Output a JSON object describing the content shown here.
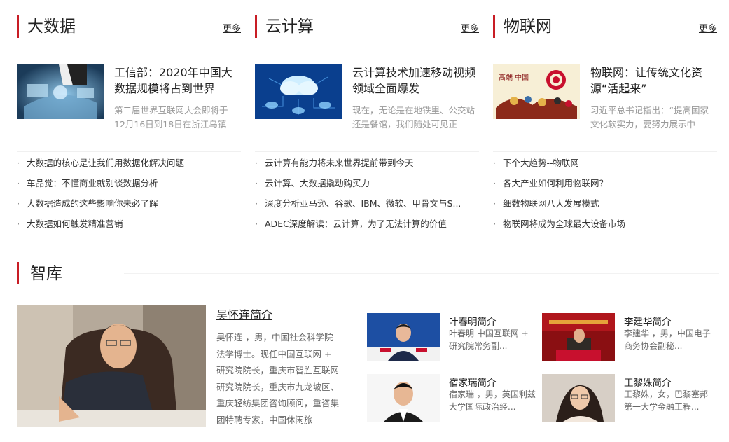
{
  "sections": [
    {
      "title": "大数据",
      "more": "更多",
      "feature_title": "工信部：2020年中国大数据规模将占到世界",
      "feature_desc": "第二届世界互联网大会即将于12月16日到18日在浙江乌镇",
      "items": [
        "大数据的核心是让我们用数据化解决问题",
        "车品觉：不懂商业就别谈数据分析",
        "大数据造成的这些影响你未必了解",
        "大数据如何触发精准营销"
      ]
    },
    {
      "title": "云计算",
      "more": "更多",
      "feature_title": "云计算技术加速移动视频领域全面爆发",
      "feature_desc": "现在，无论是在地铁里、公交站还是餐馆，我们随处可见正",
      "items": [
        "云计算有能力将未来世界提前带到今天",
        "云计算、大数据撬动购买力",
        "深度分析亚马逊、谷歌、IBM、微软、甲骨文与S...",
        "ADEC深度解读：云计算，为了无法计算的价值"
      ]
    },
    {
      "title": "物联网",
      "more": "更多",
      "feature_title": "物联网：让传统文化资源“活起来”",
      "feature_desc": "习近平总书记指出：“提高国家文化软实力，要努力展示中",
      "items": [
        "下个大趋势--物联网",
        "各大产业如何利用物联网？",
        "细数物联网八大发展模式",
        "物联网将成为全球最大设备市场"
      ]
    }
  ],
  "thumb3_text": "高端  中国",
  "zhiku": {
    "title": "智库",
    "main": {
      "name": "吴怀连简介",
      "desc": "吴怀连 ，男，中国社会科学院法学博士。现任中国互联网 + 研究院院长，重庆市智胜互联网研究院院长，重庆市九龙坡区、重庆轻纺集团咨询顾问，重咨集团特聘专家，中国休闲旅"
    },
    "people": [
      {
        "name": "叶春明简介",
        "desc": "叶春明 中国互联网 + 研究院常务副..."
      },
      {
        "name": "李建华简介",
        "desc": "李建华 ，男，中国电子商务协会副秘..."
      },
      {
        "name": "宿家瑞简介",
        "desc": "宿家瑞 ，男，英国利兹大学国际政治经..."
      },
      {
        "name": "王黎姝简介",
        "desc": "王黎姝，女，巴黎塞邦第一大学金融工程..."
      }
    ]
  },
  "colors": {
    "accent": "#c81d25"
  }
}
